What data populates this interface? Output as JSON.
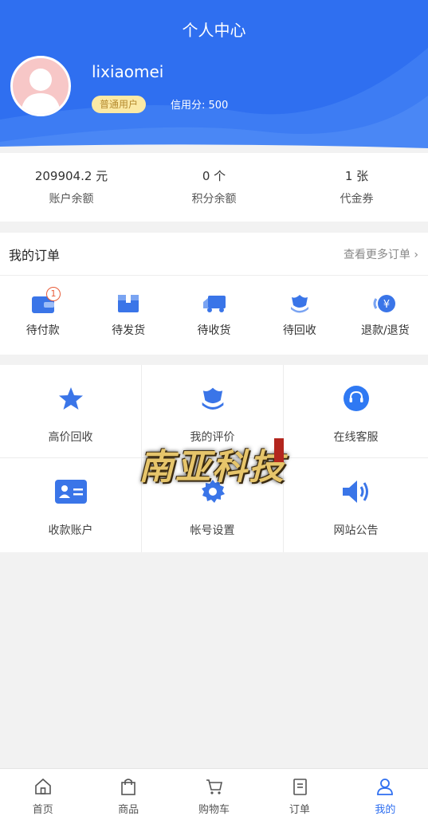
{
  "header": {
    "title": "个人中心",
    "username": "lixiaomei",
    "badge": "普通用户",
    "credit": "信用分: 500",
    "brand_color": "#2f6ff0"
  },
  "stats": [
    {
      "value": "209904.2 元",
      "label": "账户余额"
    },
    {
      "value": "0 个",
      "label": "积分余额"
    },
    {
      "value": "1 张",
      "label": "代金券"
    }
  ],
  "orders": {
    "title": "我的订单",
    "more": "查看更多订单 ›",
    "items": [
      {
        "label": "待付款",
        "icon": "wallet-icon",
        "count": "1"
      },
      {
        "label": "待发货",
        "icon": "box-icon"
      },
      {
        "label": "待收货",
        "icon": "truck-icon"
      },
      {
        "label": "待回收",
        "icon": "tulip-icon"
      },
      {
        "label": "退款/退货",
        "icon": "yen-refund-icon"
      }
    ]
  },
  "services": [
    {
      "label": "高价回收",
      "icon": "star-icon"
    },
    {
      "label": "我的评价",
      "icon": "tulip-icon"
    },
    {
      "label": "在线客服",
      "icon": "headset-icon"
    },
    {
      "label": "收款账户",
      "icon": "id-card-icon"
    },
    {
      "label": "帐号设置",
      "icon": "gear-icon"
    },
    {
      "label": "网站公告",
      "icon": "speaker-icon"
    }
  ],
  "watermark": {
    "text": "南亚科技"
  },
  "tabbar": [
    {
      "label": "首页",
      "icon": "home-icon"
    },
    {
      "label": "商品",
      "icon": "bag-icon"
    },
    {
      "label": "购物车",
      "icon": "cart-icon"
    },
    {
      "label": "订单",
      "icon": "order-doc-icon"
    },
    {
      "label": "我的",
      "icon": "user-icon",
      "active": true
    }
  ]
}
